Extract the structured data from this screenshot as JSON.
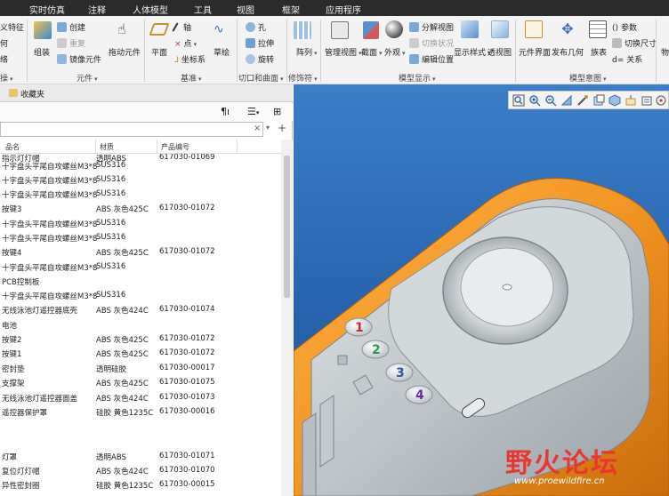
{
  "menu": [
    "实时仿真",
    "注释",
    "人体模型",
    "工具",
    "视图",
    "框架",
    "应用程序"
  ],
  "ribbon": {
    "col0": [
      "义特征",
      "何",
      "络"
    ],
    "col1_main": [
      "组装",
      "元件"
    ],
    "col1_small": [
      "创建",
      "重复",
      "镜像元件"
    ],
    "drag": "拖动元件",
    "plane": "平面",
    "axis": "轴",
    "point": "点",
    "csys": "坐标系",
    "sketch": "草绘",
    "hole": "孔",
    "extrude": "拉伸",
    "revolve": "旋转",
    "pattern": "阵列",
    "manage_view": "管理视图",
    "section": "截面",
    "appearance": "外观",
    "explode": "分解视图",
    "toggle_status": "切换状况",
    "edit_position": "编辑位置",
    "display_style": "显示样式",
    "perspective": "透视图",
    "comp_interface": "元件界面",
    "publish_geom": "发布几何",
    "family_table": "族表",
    "params": "参数",
    "switch_dims": "切换尺寸",
    "relations": "关系",
    "truncated_right": "物",
    "groups": {
      "g0": "操",
      "g1": "元件",
      "g2": "基准",
      "g3": "切口和曲面",
      "g4": "修饰符",
      "g5": "模型显示",
      "g6": "模型意图"
    }
  },
  "left_panel": {
    "tab": "收藏夹",
    "columns": [
      "品名",
      "材质",
      "产品编号"
    ],
    "rows": [
      [
        "指示灯灯帽",
        "透明ABS",
        "617030-01069"
      ],
      [
        "十字盘头平尾自攻螺丝M3*8",
        "SUS316",
        ""
      ],
      [
        "十字盘头平尾自攻螺丝M3*8",
        "SUS316",
        ""
      ],
      [
        "十字盘头平尾自攻螺丝M3*8",
        "SUS316",
        ""
      ],
      [
        "按键3",
        "ABS 灰色425C",
        "617030-01072"
      ],
      [
        "十字盘头平尾自攻螺丝M3*8",
        "SUS316",
        ""
      ],
      [
        "十字盘头平尾自攻螺丝M3*8",
        "SUS316",
        ""
      ],
      [
        "按键4",
        "ABS 灰色425C",
        "617030-01072"
      ],
      [
        "十字盘头平尾自攻螺丝M3*8",
        "SUS316",
        ""
      ],
      [
        "PCB控制板",
        "",
        ""
      ],
      [
        "十字盘头平尾自攻螺丝M3*8",
        "SUS316",
        ""
      ],
      [
        "无线泳池灯遥控器底壳",
        "ABS 灰色424C",
        "617030-01074"
      ],
      [
        "电池",
        "",
        ""
      ],
      [
        "按键2",
        "ABS 灰色425C",
        "617030-01072"
      ],
      [
        "按键1",
        "ABS 灰色425C",
        "617030-01072"
      ],
      [
        "密封垫",
        "透明硅胶",
        "617030-00017"
      ],
      [
        "支撑架",
        "ABS 灰色425C",
        "617030-01075"
      ],
      [
        "无线泳池灯遥控器面盖",
        "ABS 灰色424C",
        "617030-01073"
      ],
      [
        "遥控器保护罩",
        "硅胶 黄色1235C",
        "617030-00016"
      ],
      [
        "",
        "",
        ""
      ],
      [
        "",
        "",
        ""
      ],
      [
        "灯罩",
        "透明ABS",
        "617030-01071"
      ],
      [
        "复位灯灯帽",
        "ABS 灰色424C",
        "617030-01070"
      ],
      [
        "异性密封圈",
        "硅胶 黄色1235C",
        "617030-00015"
      ]
    ]
  },
  "viewport": {
    "buttons": [
      "zoom-fit",
      "zoom-in",
      "zoom-out",
      "refit",
      "view-orient",
      "saved-views",
      "display-style",
      "datum-display",
      "annotation-display",
      "spin-center"
    ],
    "keypad_labels": [
      "1",
      "2",
      "3",
      "4"
    ]
  },
  "watermark": {
    "text": "野火论坛",
    "url": "www.proewildfire.cn"
  }
}
